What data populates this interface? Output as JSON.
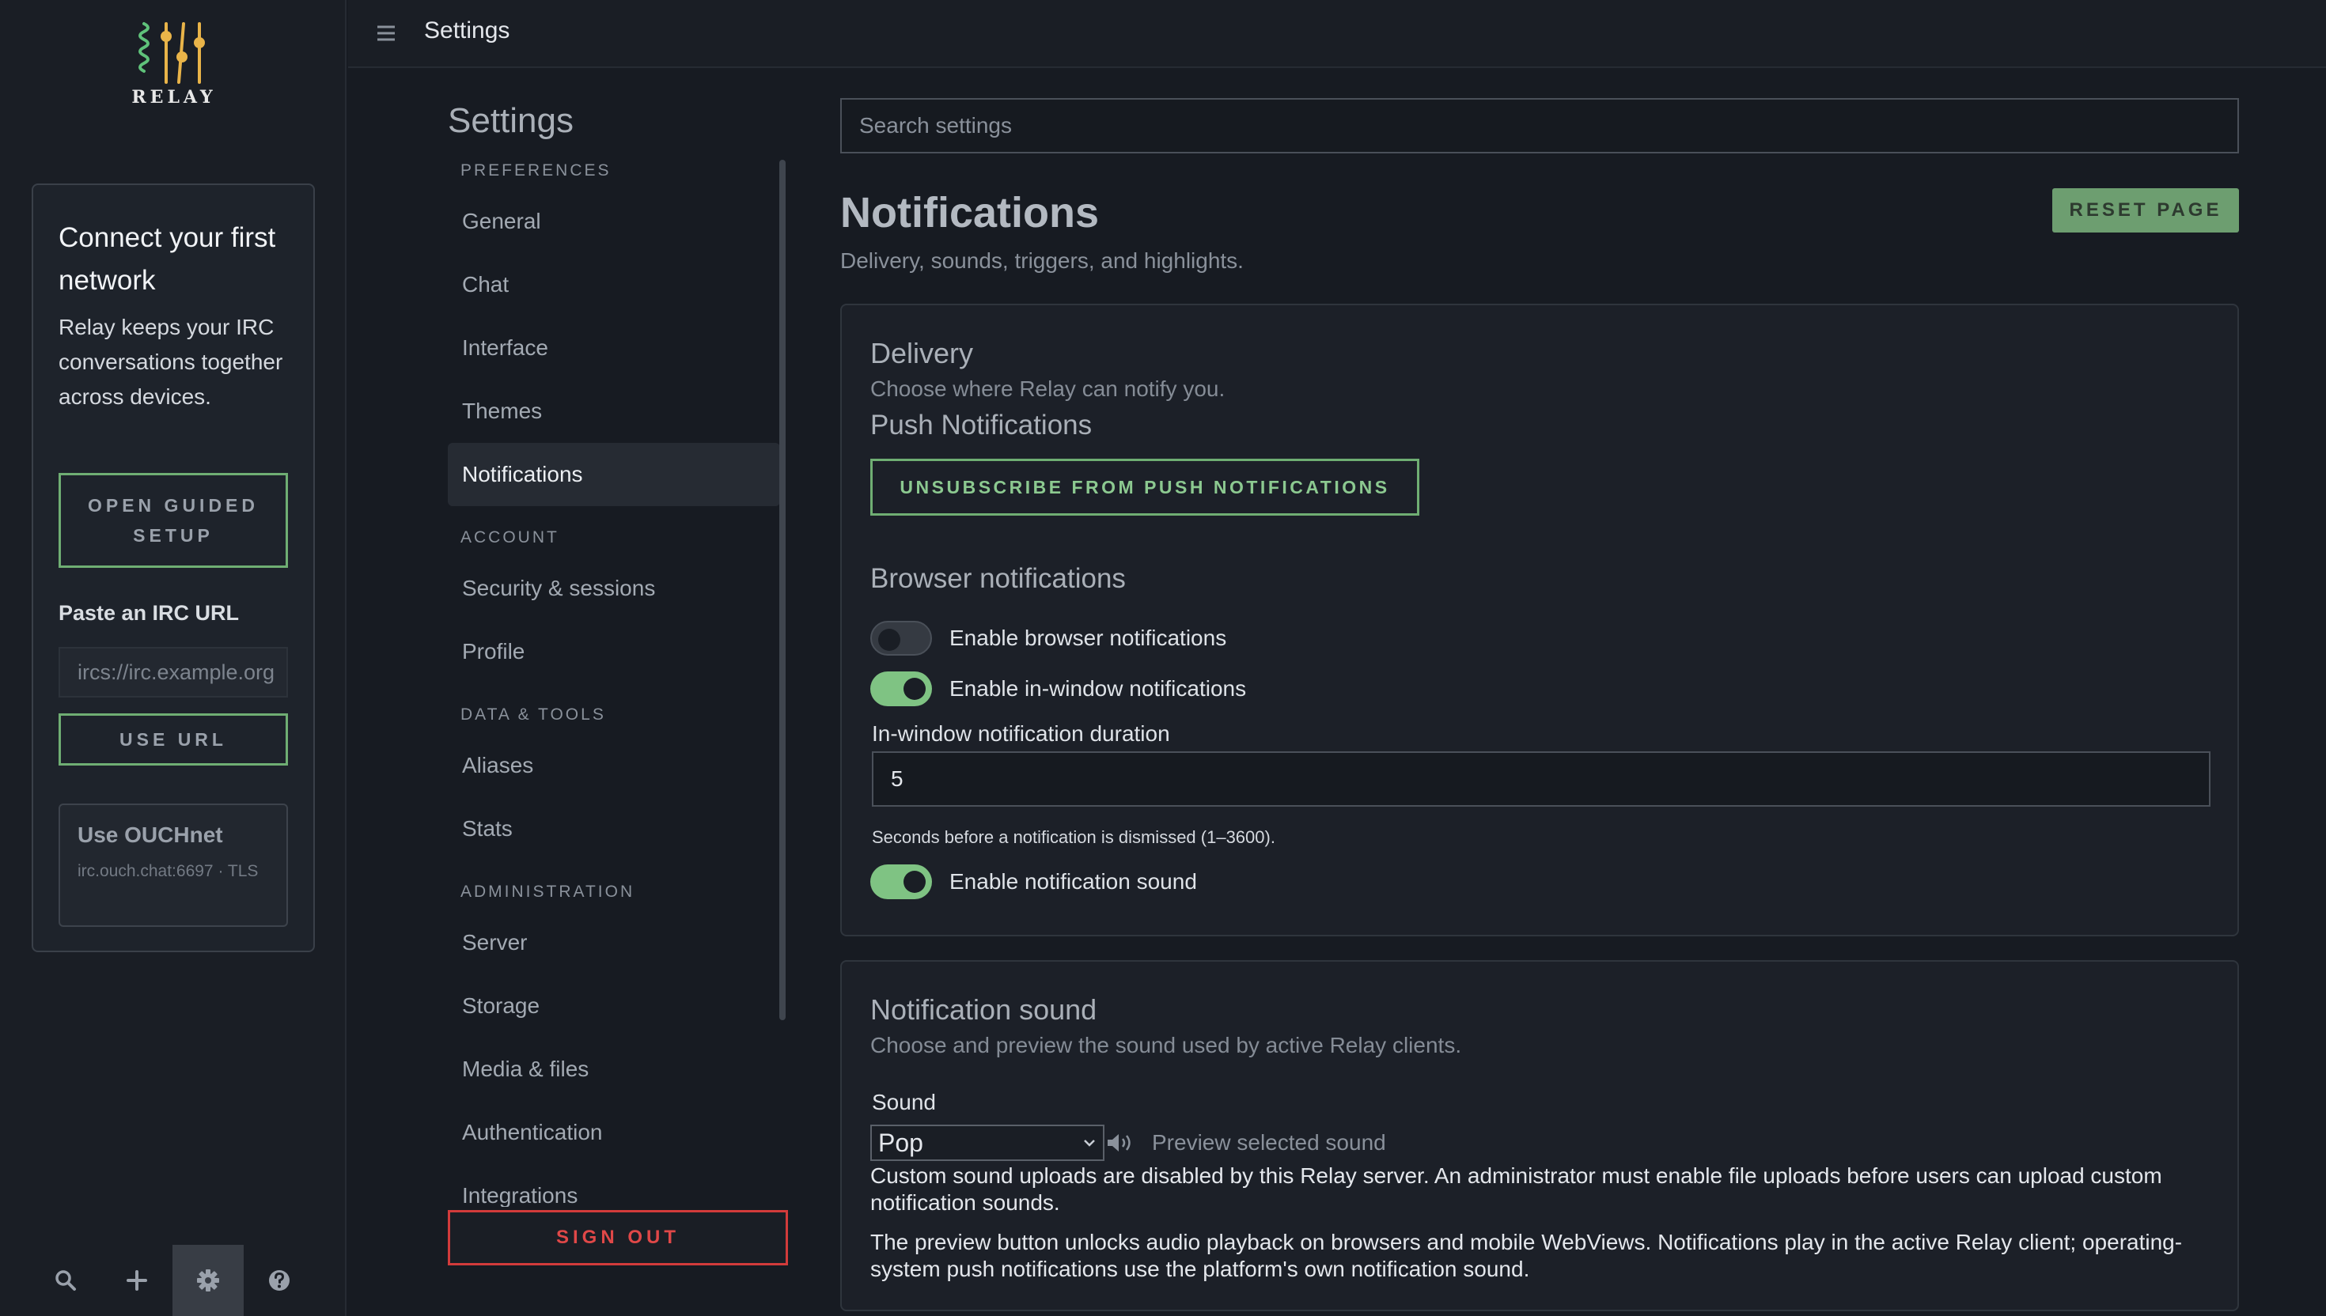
{
  "app": {
    "logo_text": "RELAY"
  },
  "topbar": {
    "title": "Settings"
  },
  "onboarding": {
    "heading": "Connect your first network",
    "description": "Relay keeps your IRC conversations together across devices.",
    "guided_setup_label": "OPEN GUIDED SETUP",
    "paste_label": "Paste an IRC URL",
    "url_placeholder": "ircs://irc.example.org",
    "use_url_label": "USE URL",
    "preset": {
      "title": "Use OUCHnet",
      "detail": "irc.ouch.chat:6697 · TLS"
    }
  },
  "rail_actions": [
    {
      "name": "search-icon"
    },
    {
      "name": "plus-icon"
    },
    {
      "name": "gear-icon",
      "active": true
    },
    {
      "name": "help-icon"
    }
  ],
  "nav": {
    "title": "Settings",
    "sections": [
      {
        "label": "PREFERENCES",
        "items": [
          "General",
          "Chat",
          "Interface",
          "Themes",
          "Notifications"
        ]
      },
      {
        "label": "ACCOUNT",
        "items": [
          "Security & sessions",
          "Profile"
        ]
      },
      {
        "label": "DATA & TOOLS",
        "items": [
          "Aliases",
          "Stats"
        ]
      },
      {
        "label": "ADMINISTRATION",
        "items": [
          "Server",
          "Storage",
          "Media & files",
          "Authentication",
          "Integrations"
        ]
      }
    ],
    "active_item": "Notifications",
    "sign_out_label": "SIGN OUT"
  },
  "main": {
    "search_placeholder": "Search settings",
    "title": "Notifications",
    "subtitle": "Delivery, sounds, triggers, and highlights.",
    "reset_label": "RESET PAGE",
    "delivery": {
      "heading": "Delivery",
      "description": "Choose where Relay can notify you.",
      "push_heading": "Push Notifications",
      "push_button": "UNSUBSCRIBE FROM PUSH NOTIFICATIONS",
      "browser_heading": "Browser notifications",
      "toggles": [
        {
          "label": "Enable browser notifications",
          "on": false
        },
        {
          "label": "Enable in-window notifications",
          "on": true
        }
      ],
      "duration_label": "In-window notification duration",
      "duration_value": "5",
      "duration_hint": "Seconds before a notification is dismissed (1–3600).",
      "sound_toggle": {
        "label": "Enable notification sound",
        "on": true
      }
    },
    "sound": {
      "heading": "Notification sound",
      "description": "Choose and preview the sound used by active Relay clients.",
      "sound_label": "Sound",
      "selected": "Pop",
      "preview_label": "Preview selected sound",
      "uploads_note": "Custom sound uploads are disabled by this Relay server. An administrator must enable file uploads before users can upload custom notification sounds.",
      "preview_note": "The preview button unlocks audio playback on browsers and mobile WebViews. Notifications play in the active Relay client; operating-system push notifications use the platform's own notification sound."
    }
  },
  "colors": {
    "accent_green": "#6fae73",
    "danger_red": "#d23b3b",
    "background": "#171b22"
  }
}
